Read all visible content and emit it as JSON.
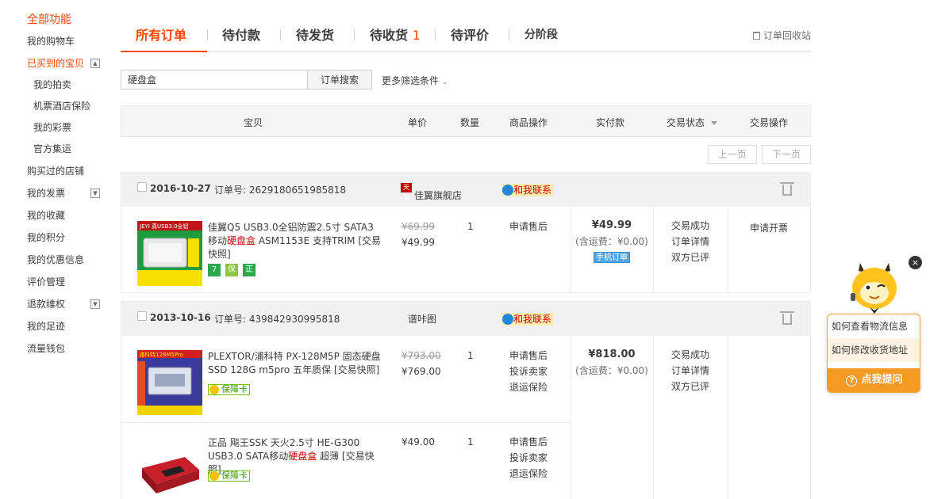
{
  "sidebar": {
    "heading": "全部功能",
    "items": [
      {
        "label": "我的购物车"
      },
      {
        "label": "已买到的宝贝"
      },
      {
        "label": "我的拍卖"
      },
      {
        "label": "机票酒店保险"
      },
      {
        "label": "我的彩票"
      },
      {
        "label": "官方集运"
      },
      {
        "label": "购买过的店铺"
      },
      {
        "label": "我的发票"
      },
      {
        "label": "我的收藏"
      },
      {
        "label": "我的积分"
      },
      {
        "label": "我的优惠信息"
      },
      {
        "label": "评价管理"
      },
      {
        "label": "退款维权"
      },
      {
        "label": "我的足迹"
      },
      {
        "label": "流量钱包"
      }
    ]
  },
  "tabs": [
    {
      "label": "所有订单"
    },
    {
      "label": "待付款"
    },
    {
      "label": "待发货"
    },
    {
      "label": "待收货",
      "count": "1"
    },
    {
      "label": "待评价"
    },
    {
      "label": "分阶段"
    }
  ],
  "recycle_label": "订单回收站",
  "search": {
    "value": "硬盘盒",
    "button": "订单搜索",
    "more_filters": "更多筛选条件"
  },
  "table_headers": {
    "item": "宝贝",
    "unit_price": "单价",
    "quantity": "数量",
    "item_ops": "商品操作",
    "paid": "实付款",
    "status": "交易状态",
    "actions": "交易操作"
  },
  "pager": {
    "prev": "上一页",
    "next": "下一页"
  },
  "orders": [
    {
      "date": "2016-10-27",
      "order_no_label": "订单号:",
      "order_no": "2629180651985818",
      "shop": "佳翼旗舰店",
      "shop_tag": "天猫",
      "contact": "和我联系",
      "items": [
        {
          "thumb_text": "JEYI 真USB3.0全铝",
          "title_pre": "佳翼Q5 USB3.0全铝防震2.5寸 SATA3移动",
          "title_hl": "硬盘盒",
          "title_post": " ASM1153E 支持TRIM [交易快照]",
          "price_old": "¥69.99",
          "price_new": "¥49.99",
          "qty": "1",
          "ops": [
            "申请售后"
          ],
          "badges": [
            "7",
            "保",
            "正"
          ]
        }
      ],
      "total": "¥49.99",
      "shipping": "(含运费：¥0.00)",
      "mobile_tag": "手机订单",
      "status": [
        "交易成功",
        "订单详情",
        "双方已评"
      ],
      "action": "申请开票"
    },
    {
      "date": "2013-10-16",
      "order_no_label": "订单号:",
      "order_no": "439842930995818",
      "shop": "谱咔图",
      "contact": "和我联系",
      "items": [
        {
          "thumb_text": "浦科特128M5Pro",
          "title_pre": "PLEXTOR/浦科特 PX-128M5P 固态硬盘 SSD 128G m5pro 五年质保 [交易快照]",
          "price_old": "¥793.00",
          "price_new": "¥769.00",
          "qty": "1",
          "ops": [
            "申请售后",
            "投诉卖家",
            "退运保险"
          ],
          "guarantee": "保障卡"
        },
        {
          "title_pre": "正品 飚王SSK 天火2.5寸 HE-G300 USB3.0 SATA移动",
          "title_hl": "硬盘盒",
          "title_post": " 超薄 [交易快照]",
          "price_new": "¥49.00",
          "qty": "1",
          "ops": [
            "申请售后",
            "投诉卖家",
            "退运保险"
          ],
          "guarantee": "保障卡"
        }
      ],
      "total": "¥818.00",
      "shipping": "(含运费：¥0.00)",
      "status": [
        "交易成功",
        "订单详情",
        "双方已评"
      ]
    }
  ],
  "assistant": {
    "questions": [
      "如何查看物流信息",
      "如何修改收货地址"
    ],
    "ask_button": "点我提问",
    "close": "×"
  },
  "colors": {
    "accent": "#ff4400",
    "price_highlight": "#c40000",
    "assistant": "#f59a23"
  }
}
